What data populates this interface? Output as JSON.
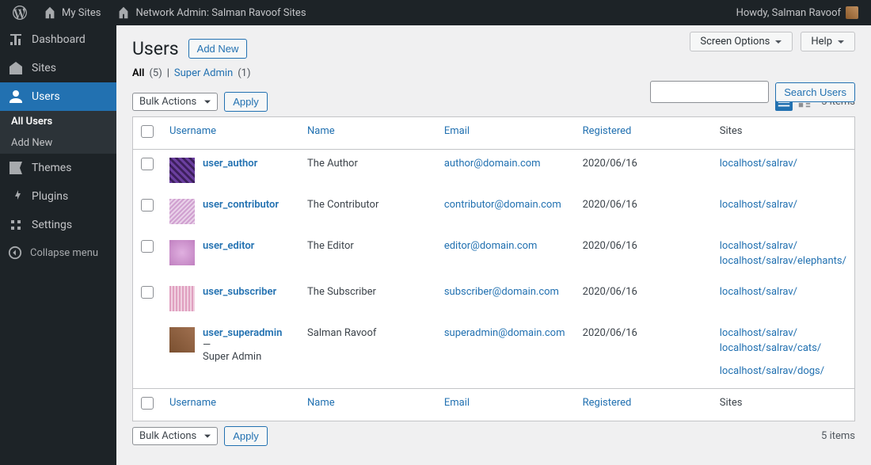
{
  "adminbar": {
    "my_sites": "My Sites",
    "network_admin": "Network Admin: Salman Ravoof Sites",
    "howdy": "Howdy, Salman Ravoof"
  },
  "sidebar": {
    "dashboard": "Dashboard",
    "sites": "Sites",
    "users": "Users",
    "all_users": "All Users",
    "add_new": "Add New",
    "themes": "Themes",
    "plugins": "Plugins",
    "settings": "Settings",
    "collapse": "Collapse menu"
  },
  "top": {
    "screen_options": "Screen Options",
    "help": "Help"
  },
  "page": {
    "title": "Users",
    "add_new": "Add New"
  },
  "filters": {
    "all_label": "All",
    "all_count": "(5)",
    "sep": "|",
    "super_label": "Super Admin",
    "super_count": "(1)"
  },
  "actions": {
    "bulk": "Bulk Actions",
    "apply": "Apply",
    "search": "Search Users"
  },
  "count_text": "5 items",
  "columns": {
    "username": "Username",
    "name": "Name",
    "email": "Email",
    "registered": "Registered",
    "sites": "Sites"
  },
  "super_admin_badge": "Super Admin",
  "dash": " — ",
  "rows": [
    {
      "username": "user_author",
      "name": "The Author",
      "email": "author@domain.com",
      "registered": "2020/06/16",
      "sites": [
        "localhost/salrav/"
      ],
      "avatar": "a1",
      "super": false
    },
    {
      "username": "user_contributor",
      "name": "The Contributor",
      "email": "contributor@domain.com",
      "registered": "2020/06/16",
      "sites": [
        "localhost/salrav/"
      ],
      "avatar": "a2",
      "super": false
    },
    {
      "username": "user_editor",
      "name": "The Editor",
      "email": "editor@domain.com",
      "registered": "2020/06/16",
      "sites": [
        "localhost/salrav/",
        "localhost/salrav/elephants/"
      ],
      "avatar": "a3",
      "super": false
    },
    {
      "username": "user_subscriber",
      "name": "The Subscriber",
      "email": "subscriber@domain.com",
      "registered": "2020/06/16",
      "sites": [
        "localhost/salrav/"
      ],
      "avatar": "a4",
      "super": false
    },
    {
      "username": "user_superadmin",
      "name": "Salman Ravoof",
      "email": "superadmin@domain.com",
      "registered": "2020/06/16",
      "sites": [
        "localhost/salrav/",
        "localhost/salrav/cats/",
        "localhost/salrav/dogs/"
      ],
      "avatar": "a5",
      "super": true
    }
  ]
}
